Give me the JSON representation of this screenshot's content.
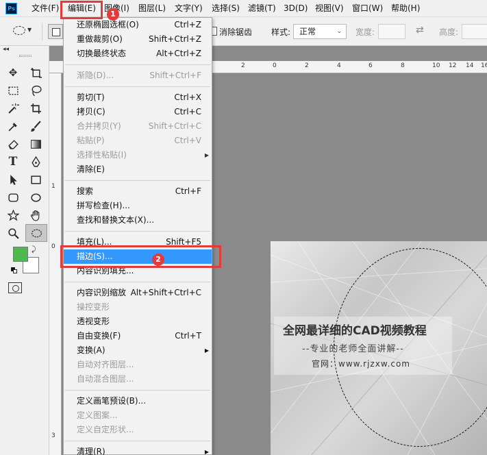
{
  "app": {
    "logo_text": "Ps"
  },
  "menubar": {
    "items": [
      {
        "label": "文件(F)"
      },
      {
        "label": "编辑(E)"
      },
      {
        "label": "图像(I)"
      },
      {
        "label": "图层(L)"
      },
      {
        "label": "文字(Y)"
      },
      {
        "label": "选择(S)"
      },
      {
        "label": "滤镜(T)"
      },
      {
        "label": "3D(D)"
      },
      {
        "label": "视图(V)"
      },
      {
        "label": "窗口(W)"
      },
      {
        "label": "帮助(H)"
      }
    ]
  },
  "options": {
    "antialias_label": "消除锯齿",
    "style_label": "样式:",
    "style_value": "正常",
    "width_label": "宽度:",
    "height_label": "高度:"
  },
  "edit_menu": {
    "items": [
      {
        "label": "还原椭圆选框(O)",
        "shortcut": "Ctrl+Z",
        "enabled": true
      },
      {
        "label": "重做裁剪(O)",
        "shortcut": "Shift+Ctrl+Z",
        "enabled": true
      },
      {
        "label": "切换最终状态",
        "shortcut": "Alt+Ctrl+Z",
        "enabled": true
      },
      {
        "label": "渐隐(D)...",
        "shortcut": "Shift+Ctrl+F",
        "enabled": false
      },
      {
        "label": "剪切(T)",
        "shortcut": "Ctrl+X",
        "enabled": true
      },
      {
        "label": "拷贝(C)",
        "shortcut": "Ctrl+C",
        "enabled": true
      },
      {
        "label": "合并拷贝(Y)",
        "shortcut": "Shift+Ctrl+C",
        "enabled": false
      },
      {
        "label": "粘贴(P)",
        "shortcut": "Ctrl+V",
        "enabled": false
      },
      {
        "label": "选择性粘贴(I)",
        "shortcut": "",
        "enabled": false,
        "submenu": true
      },
      {
        "label": "清除(E)",
        "shortcut": "",
        "enabled": true
      },
      {
        "label": "搜索",
        "shortcut": "Ctrl+F",
        "enabled": true
      },
      {
        "label": "拼写检查(H)...",
        "shortcut": "",
        "enabled": true
      },
      {
        "label": "查找和替换文本(X)...",
        "shortcut": "",
        "enabled": true
      },
      {
        "label": "填充(L)...",
        "shortcut": "Shift+F5",
        "enabled": true
      },
      {
        "label": "描边(S)...",
        "shortcut": "",
        "enabled": true,
        "highlighted": true
      },
      {
        "label": "内容识别填充...",
        "shortcut": "",
        "enabled": true
      },
      {
        "label": "内容识别缩放",
        "shortcut": "Alt+Shift+Ctrl+C",
        "enabled": true
      },
      {
        "label": "操控变形",
        "shortcut": "",
        "enabled": false
      },
      {
        "label": "透视变形",
        "shortcut": "",
        "enabled": true
      },
      {
        "label": "自由变换(F)",
        "shortcut": "Ctrl+T",
        "enabled": true
      },
      {
        "label": "变换(A)",
        "shortcut": "",
        "enabled": true,
        "submenu": true
      },
      {
        "label": "自动对齐图层...",
        "shortcut": "",
        "enabled": false
      },
      {
        "label": "自动混合图层...",
        "shortcut": "",
        "enabled": false
      },
      {
        "label": "定义画笔预设(B)...",
        "shortcut": "",
        "enabled": true
      },
      {
        "label": "定义图案...",
        "shortcut": "",
        "enabled": false
      },
      {
        "label": "定义自定形状...",
        "shortcut": "",
        "enabled": false
      },
      {
        "label": "清理(R)",
        "shortcut": "",
        "enabled": true,
        "submenu": true
      }
    ]
  },
  "ruler": {
    "top_numbers": [
      "2",
      "0",
      "2",
      "4",
      "6",
      "8",
      "10",
      "12",
      "14",
      "16"
    ],
    "left_numbers": [
      "1",
      "0",
      "3"
    ]
  },
  "canvas": {
    "title": "全网最详细的CAD视频教程",
    "subtitle": "--专业的老师全面讲解--",
    "site": "官网：www.rjzxw.com"
  },
  "annotations": {
    "badge_1": "1",
    "badge_2": "2"
  },
  "colors": {
    "foreground": "#4fb84f",
    "background": "#ffffff",
    "highlight": "#3399ff",
    "annotation": "#e03c3c"
  }
}
